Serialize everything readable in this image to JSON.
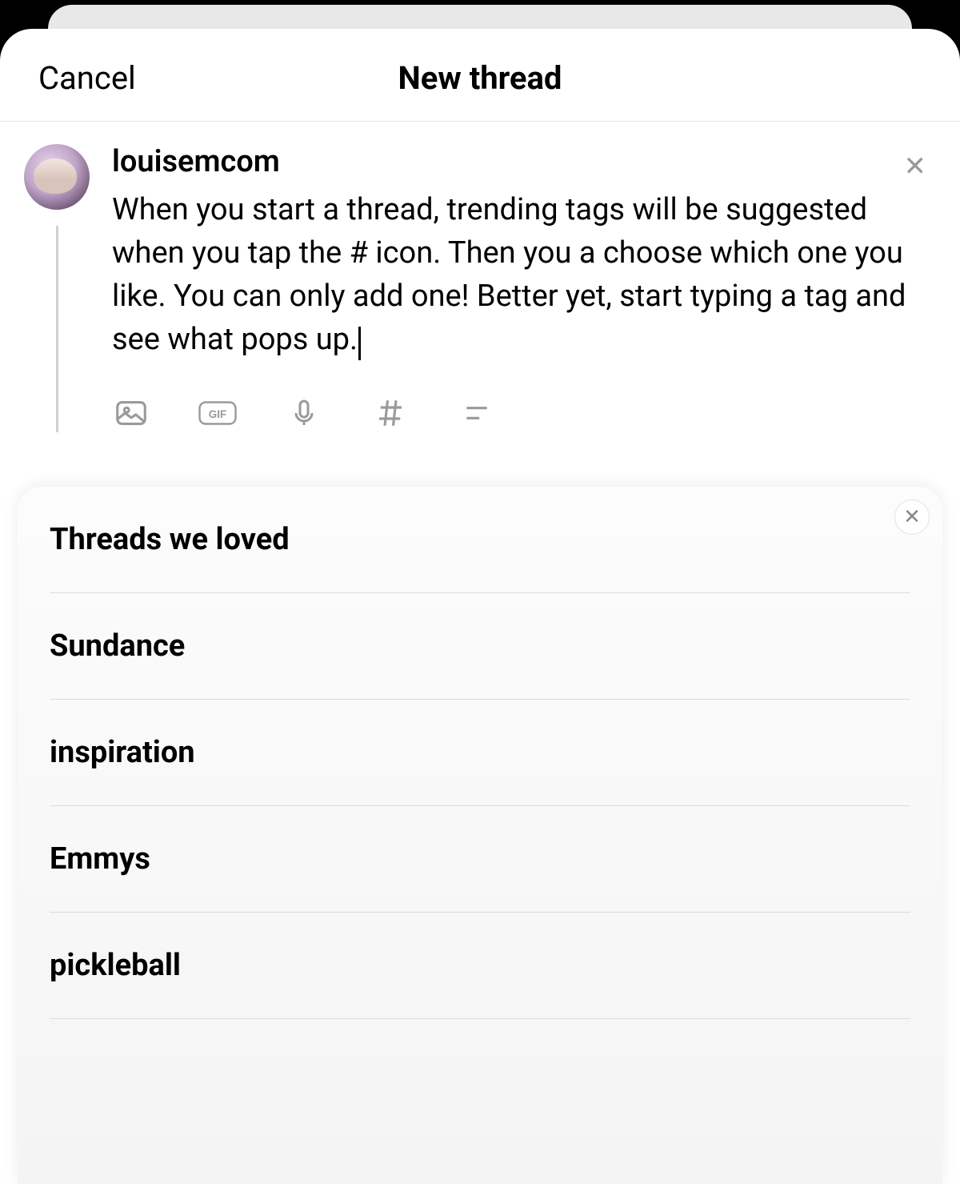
{
  "header": {
    "cancel_label": "Cancel",
    "title": "New thread"
  },
  "compose": {
    "username": "louisemcom",
    "text": "When you start a thread, trending tags will be suggested when you tap the # icon. Then you a choose which one you like. You can only add one! Better yet, start typing a tag and see what pops up.",
    "remove_icon": "✕",
    "toolbar_icons": {
      "photo": "photo-icon",
      "gif": "gif-icon",
      "mic": "mic-icon",
      "hashtag": "hashtag-icon",
      "menu": "menu-icon"
    }
  },
  "suggestions": {
    "close_icon": "✕",
    "items": [
      "Threads we loved",
      "Sundance",
      "inspiration",
      "Emmys",
      "pickleball"
    ]
  }
}
